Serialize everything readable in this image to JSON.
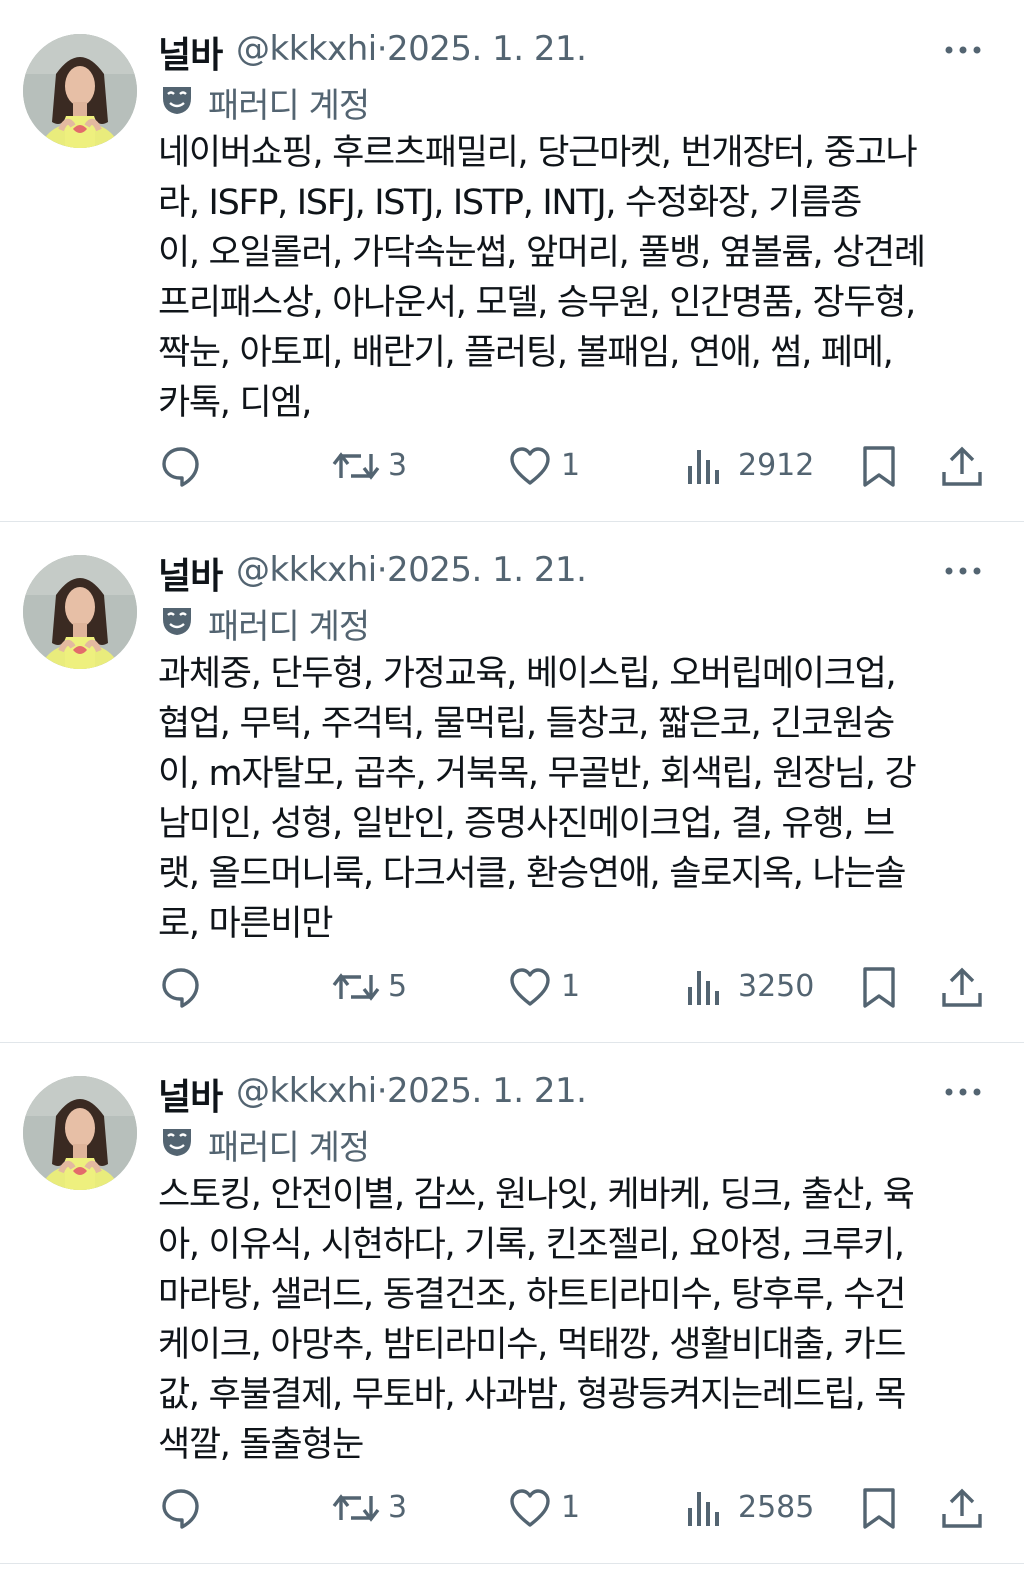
{
  "tweets": [
    {
      "display_name": "널바",
      "handle": "@kkkxhi",
      "separator": "·",
      "date": "2025. 1. 21.",
      "parody_label": "패러디 계정",
      "text_lines": [
        "네이버쇼핑, 후르츠패밀리, 당근마켓, 번개장터, 중고나",
        "라, ISFP, ISFJ, ISTJ, ISTP, INTJ, 수정화장, 기름종",
        "이, 오일롤러, 가닥속눈썹, 앞머리, 풀뱅, 옆볼륨, 상견례",
        "프리패스상, 아나운서, 모델, 승무원, 인간명품, 장두형,",
        "짝눈, 아토피, 배란기, 플러팅, 볼패임, 연애, 썸, 페메,",
        "카톡, 디엠,"
      ],
      "reposts": "3",
      "likes": "1",
      "views": "2912"
    },
    {
      "display_name": "널바",
      "handle": "@kkkxhi",
      "separator": "·",
      "date": "2025. 1. 21.",
      "parody_label": "패러디 계정",
      "text_lines": [
        "과체중, 단두형, 가정교육, 베이스립, 오버립메이크업,",
        "협업, 무턱, 주걱턱, 물먹립, 들창코, 짧은코, 긴코원숭",
        "이, m자탈모, 곱추, 거북목, 무골반, 회색립, 원장님, 강",
        "남미인, 성형, 일반인, 증명사진메이크업, 결, 유행, 브",
        "랫, 올드머니룩, 다크서클, 환승연애, 솔로지옥, 나는솔",
        "로, 마른비만"
      ],
      "reposts": "5",
      "likes": "1",
      "views": "3250"
    },
    {
      "display_name": "널바",
      "handle": "@kkkxhi",
      "separator": "·",
      "date": "2025. 1. 21.",
      "parody_label": "패러디 계정",
      "text_lines": [
        "스토킹, 안전이별, 감쓰, 원나잇, 케바케, 딩크, 출산, 육",
        "아, 이유식, 시현하다, 기록, 킨조젤리, 요아정, 크루키,",
        "마라탕, 샐러드, 동결건조, 하트티라미수, 탕후루, 수건",
        "케이크, 아망추, 밤티라미수, 먹태깡, 생활비대출, 카드",
        "값, 후불결제, 무토바, 사과밤, 형광등켜지는레드립, 목",
        "색깔, 돌출형눈"
      ],
      "reposts": "3",
      "likes": "1",
      "views": "2585"
    }
  ],
  "icons": {
    "reply": "reply-bubble-icon",
    "repost": "repost-arrows-icon",
    "like": "heart-icon",
    "views": "bar-chart-icon",
    "bookmark": "bookmark-icon",
    "share": "share-upload-icon",
    "more": "more-dots-icon",
    "parody": "theater-mask-icon"
  },
  "colors": {
    "text": "#0f1419",
    "secondary": "#536471",
    "divider": "#e1e6ea"
  }
}
